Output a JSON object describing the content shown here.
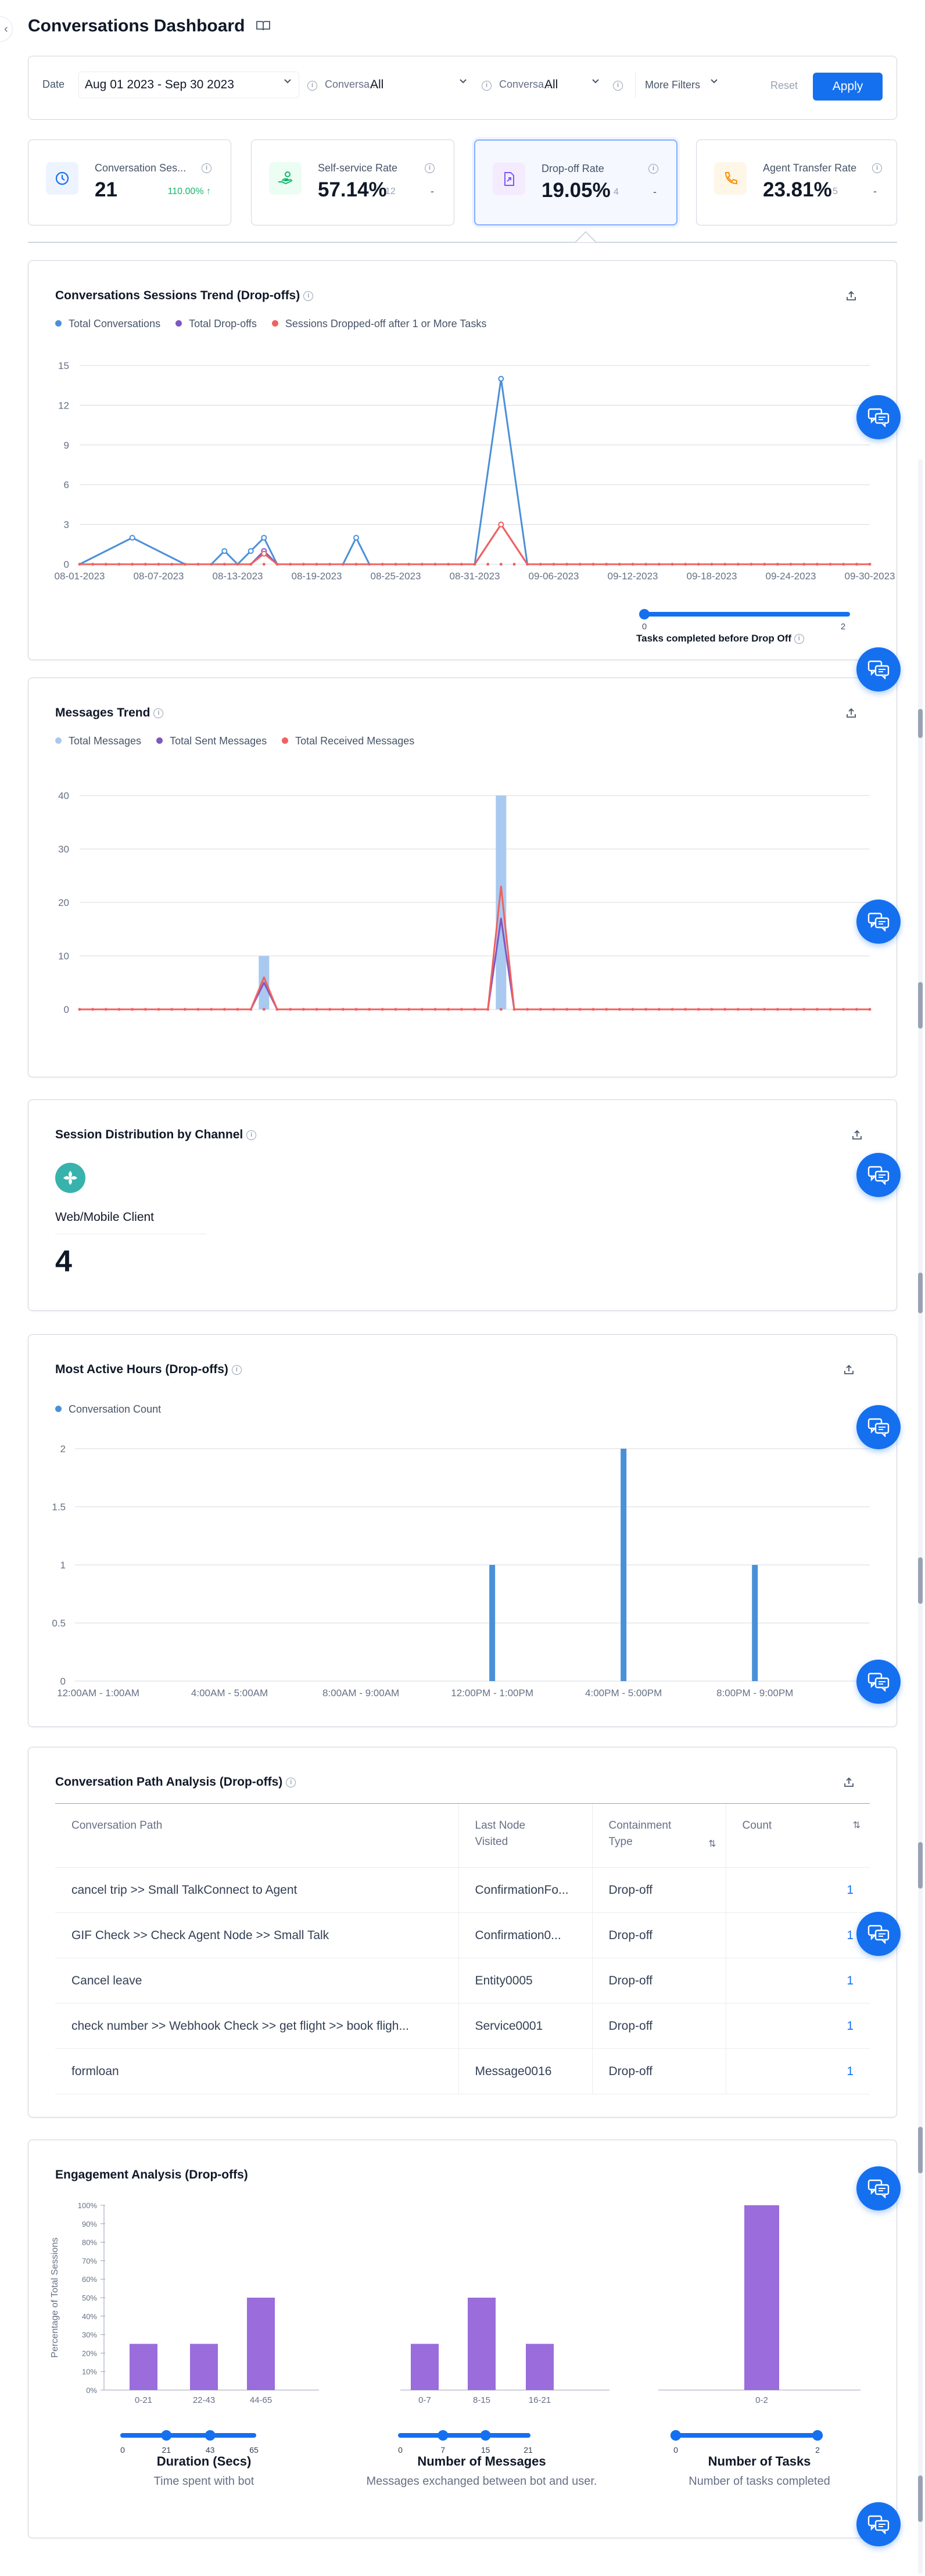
{
  "page": {
    "title": "Conversations Dashboard"
  },
  "filters": {
    "date_label": "Date",
    "date_value": "Aug 01 2023 - Sep 30 2023",
    "f1_label": "Conversa...",
    "f1_value": "All",
    "f2_label": "Conversa...",
    "f2_value": "All",
    "more": "More Filters",
    "reset": "Reset",
    "apply": "Apply"
  },
  "kpis": [
    {
      "label": "Conversation Ses...",
      "value": "21",
      "trend": "110.00%",
      "dash": ""
    },
    {
      "label": "Self-service Rate",
      "value": "57.14%",
      "sub": "12",
      "dash": "-"
    },
    {
      "label": "Drop-off Rate",
      "value": "19.05%",
      "sub": "4",
      "dash": "-"
    },
    {
      "label": "Agent Transfer Rate",
      "value": "23.81%",
      "sub": "5",
      "dash": "-"
    }
  ],
  "colors": {
    "accent": "#1570ef",
    "blue": "#4a90d9",
    "purple": "#7e57c2",
    "red": "#f0625f",
    "bar_light": "#a9c9f0",
    "bar_purple": "#9b6cdb"
  },
  "sessions_trend": {
    "title": "Conversations Sessions Trend (Drop-offs)",
    "legend": [
      "Total Conversations",
      "Total Drop-offs",
      "Sessions Dropped-off after 1 or More Tasks"
    ],
    "slider_min": "0",
    "slider_max": "2",
    "slider_label": "Tasks completed before Drop Off"
  },
  "messages_trend": {
    "title": "Messages Trend",
    "legend": [
      "Total Messages",
      "Total Sent Messages",
      "Total Received Messages"
    ]
  },
  "channel": {
    "title": "Session Distribution by Channel",
    "name": "Web/Mobile Client",
    "count": "4"
  },
  "active_hours": {
    "title": "Most Active Hours (Drop-offs)",
    "legend": [
      "Conversation Count"
    ]
  },
  "paths": {
    "title": "Conversation Path Analysis (Drop-offs)",
    "headers": [
      "Conversation Path",
      "Last Node Visited",
      "Containment Type",
      "Count"
    ],
    "rows": [
      [
        "cancel trip >> Small TalkConnect to Agent",
        "ConfirmationFo...",
        "Drop-off",
        "1"
      ],
      [
        "GIF Check >> Check Agent Node >> Small Talk",
        "Confirmation0...",
        "Drop-off",
        "1"
      ],
      [
        "Cancel leave",
        "Entity0005",
        "Drop-off",
        "1"
      ],
      [
        "check number >> Webhook Check >> get flight >> book fligh...",
        "Service0001",
        "Drop-off",
        "1"
      ],
      [
        "formloan",
        "Message0016",
        "Drop-off",
        "1"
      ]
    ]
  },
  "engagement": {
    "title": "Engagement Analysis (Drop-offs)",
    "ylabel": "Percentage of Total Sessions",
    "groups": [
      {
        "label": "Duration (Secs)",
        "desc": "Time spent with bot",
        "slider_ticks": [
          "0",
          "21",
          "43",
          "65"
        ]
      },
      {
        "label": "Number of Messages",
        "desc": "Messages exchanged between bot and user.",
        "slider_ticks": [
          "0",
          "7",
          "15",
          "21"
        ]
      },
      {
        "label": "Number of Tasks",
        "desc": "Number of tasks completed",
        "slider_ticks": [
          "0",
          "2"
        ]
      }
    ]
  },
  "chart_data": [
    {
      "type": "line",
      "title": "Conversations Sessions Trend (Drop-offs)",
      "x_ticks": [
        "08-01-2023",
        "08-07-2023",
        "08-13-2023",
        "08-19-2023",
        "08-25-2023",
        "08-31-2023",
        "09-06-2023",
        "09-12-2023",
        "09-18-2023",
        "09-24-2023",
        "09-30-2023"
      ],
      "x_tick_days": [
        0,
        6,
        12,
        18,
        24,
        30,
        36,
        42,
        48,
        54,
        60
      ],
      "ylim": [
        0,
        15
      ],
      "y_ticks": [
        0,
        3,
        6,
        9,
        12,
        15
      ],
      "n_points": 61,
      "series": [
        {
          "name": "Total Conversations",
          "color": "#4a90d9",
          "points": [
            [
              0,
              0
            ],
            [
              4,
              2
            ],
            [
              8,
              0
            ],
            [
              10,
              0
            ],
            [
              11,
              1
            ],
            [
              12,
              0
            ],
            [
              13,
              1
            ],
            [
              14,
              2
            ],
            [
              15,
              0
            ],
            [
              16,
              0
            ],
            [
              17,
              0
            ],
            [
              18,
              0
            ],
            [
              20,
              0
            ],
            [
              21,
              2
            ],
            [
              22,
              0
            ],
            [
              23,
              0
            ],
            [
              24,
              0
            ],
            [
              25,
              0
            ],
            [
              26,
              0
            ],
            [
              27,
              0
            ],
            [
              28,
              0
            ],
            [
              29,
              0
            ],
            [
              30,
              0
            ],
            [
              32,
              14
            ],
            [
              34,
              0
            ],
            [
              60,
              0
            ]
          ]
        },
        {
          "name": "Total Drop-offs",
          "color": "#7e57c2",
          "points": [
            [
              0,
              0
            ],
            [
              10,
              0
            ],
            [
              11,
              0
            ],
            [
              12,
              0
            ],
            [
              13,
              0
            ],
            [
              14,
              1
            ],
            [
              15,
              0
            ],
            [
              29,
              0
            ],
            [
              30,
              0
            ],
            [
              32,
              3
            ],
            [
              34,
              0
            ],
            [
              60,
              0
            ]
          ]
        },
        {
          "name": "Sessions Dropped-off after 1 or More Tasks",
          "color": "#f0625f",
          "points": [
            [
              0,
              0
            ],
            [
              13,
              0
            ],
            [
              14,
              0.8
            ],
            [
              15,
              0
            ],
            [
              30,
              0
            ],
            [
              32,
              3
            ],
            [
              34,
              0
            ],
            [
              60,
              0
            ]
          ]
        }
      ]
    },
    {
      "type": "bar",
      "title": "Messages Trend",
      "x_ticks": [
        "08-01-2023",
        "08-07-2023",
        "08-13-2023",
        "08-19-2023",
        "08-25-2023",
        "08-31-2023",
        "09-06-2023",
        "09-12-2023",
        "09-18-2023",
        "09-24-2023",
        "09-30-2023"
      ],
      "x_tick_days": [
        0,
        6,
        12,
        18,
        24,
        30,
        36,
        42,
        48,
        54,
        60
      ],
      "ylim": [
        0,
        40
      ],
      "y_ticks": [
        0,
        10,
        20,
        30,
        40
      ],
      "bars": [
        {
          "day": 14,
          "value": 10
        },
        {
          "day": 32,
          "value": 40
        }
      ],
      "series": [
        {
          "name": "Total Sent Messages",
          "color": "#7e57c2",
          "points": [
            [
              0,
              0
            ],
            [
              13,
              0
            ],
            [
              14,
              5
            ],
            [
              15,
              0
            ],
            [
              31,
              0
            ],
            [
              32,
              17
            ],
            [
              33,
              0
            ],
            [
              60,
              0
            ]
          ]
        },
        {
          "name": "Total Received Messages",
          "color": "#f0625f",
          "points": [
            [
              0,
              0
            ],
            [
              13,
              0
            ],
            [
              14,
              6
            ],
            [
              15,
              0
            ],
            [
              31,
              0
            ],
            [
              32,
              23
            ],
            [
              33,
              0
            ],
            [
              60,
              0
            ]
          ]
        }
      ]
    },
    {
      "type": "bar",
      "title": "Most Active Hours (Drop-offs)",
      "categories": [
        "12:00AM - 1:00AM",
        "4:00AM - 5:00AM",
        "8:00AM - 9:00AM",
        "12:00PM - 1:00PM",
        "4:00PM - 5:00PM",
        "8:00PM - 9:00PM"
      ],
      "category_hours": [
        0,
        4,
        8,
        12,
        16,
        20
      ],
      "ylim": [
        0,
        2
      ],
      "y_ticks": [
        0,
        0.5,
        1,
        1.5,
        2
      ],
      "bars": [
        {
          "hour": 12,
          "value": 1
        },
        {
          "hour": 16,
          "value": 2
        },
        {
          "hour": 20,
          "value": 1
        }
      ]
    },
    {
      "type": "bar",
      "title": "Engagement Analysis (Drop-offs)",
      "ylim": [
        0,
        100
      ],
      "y_ticks": [
        "0%",
        "10%",
        "20%",
        "30%",
        "40%",
        "50%",
        "60%",
        "70%",
        "80%",
        "90%",
        "100%"
      ],
      "groups": [
        {
          "name": "Duration (Secs)",
          "categories": [
            "0-21",
            "22-43",
            "44-65"
          ],
          "values": [
            25,
            25,
            50
          ]
        },
        {
          "name": "Number of Messages",
          "categories": [
            "0-7",
            "8-15",
            "16-21"
          ],
          "values": [
            25,
            50,
            25
          ]
        },
        {
          "name": "Number of Tasks",
          "categories": [
            "0-2"
          ],
          "values": [
            100
          ]
        }
      ]
    }
  ]
}
